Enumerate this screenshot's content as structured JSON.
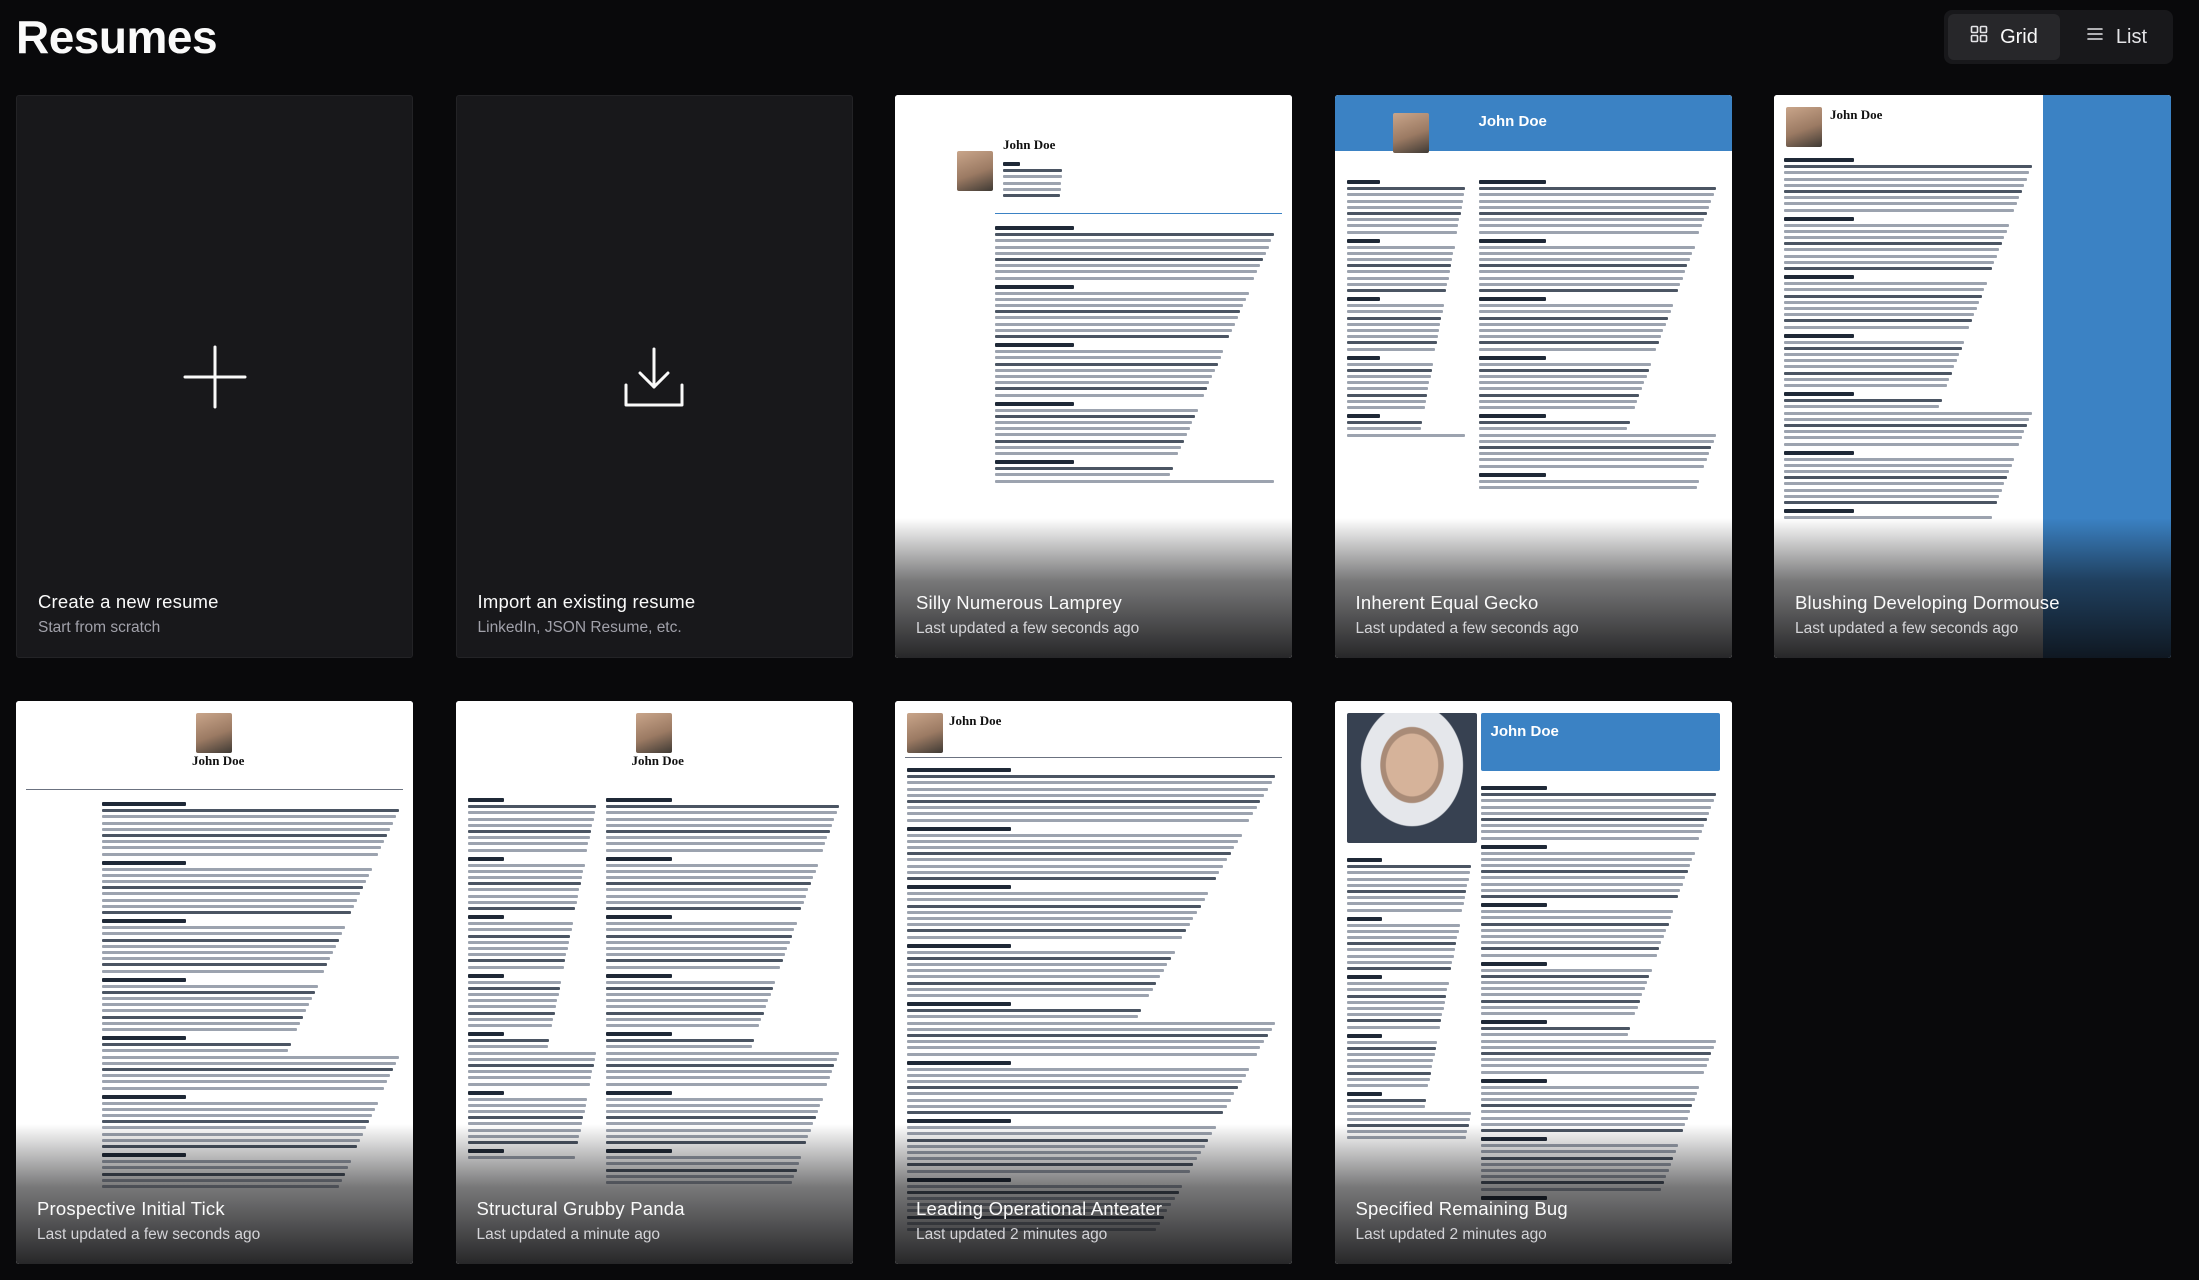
{
  "page": {
    "title": "Resumes"
  },
  "view_toggle": {
    "grid_label": "Grid",
    "list_label": "List",
    "active": "grid"
  },
  "actions": [
    {
      "title": "Create a new resume",
      "subtitle": "Start from scratch",
      "icon": "plus-icon"
    },
    {
      "title": "Import an existing resume",
      "subtitle": "LinkedIn, JSON Resume, etc.",
      "icon": "download-icon"
    }
  ],
  "resumes": [
    {
      "title": "Silly Numerous Lamprey",
      "updated": "Last updated a few seconds ago",
      "template": "header-logo"
    },
    {
      "title": "Inherent Equal Gecko",
      "updated": "Last updated a few seconds ago",
      "template": "blue-header"
    },
    {
      "title": "Blushing Developing Dormouse",
      "updated": "Last updated a few seconds ago",
      "template": "blue-sidebar"
    },
    {
      "title": "Prospective Initial Tick",
      "updated": "Last updated a few seconds ago",
      "template": "centered-photo"
    },
    {
      "title": "Structural Grubby Panda",
      "updated": "Last updated a minute ago",
      "template": "centered-two-column"
    },
    {
      "title": "Leading Operational Anteater",
      "updated": "Last updated 2 minutes ago",
      "template": "classic"
    },
    {
      "title": "Specified Remaining Bug",
      "updated": "Last updated 2 minutes ago",
      "template": "photo-blue-box"
    }
  ],
  "preview": {
    "name": "John Doe",
    "accent": "#3b82c4"
  },
  "colors": {
    "background": "#09090b",
    "card": "#18181b",
    "muted_text": "#a1a1aa"
  }
}
